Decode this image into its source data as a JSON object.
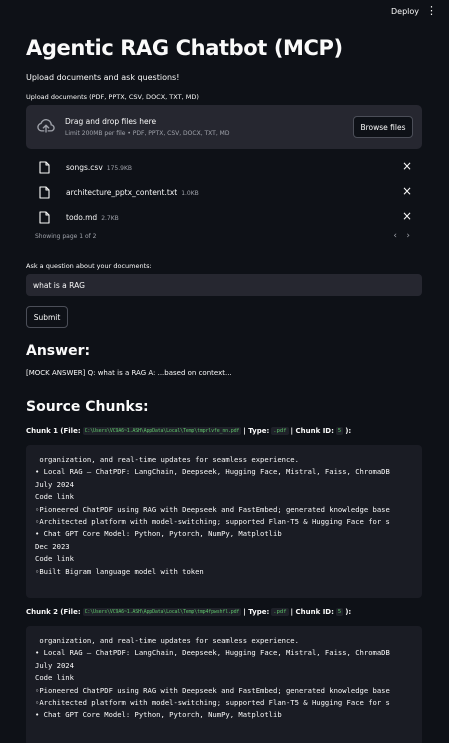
{
  "header": {
    "deploy_label": "Deploy",
    "menu_icon": "kebab-menu-icon"
  },
  "page": {
    "title": "Agentic RAG Chatbot (MCP)",
    "subtitle": "Upload documents and ask questions!"
  },
  "uploader": {
    "label": "Upload documents (PDF, PPTX, CSV, DOCX, TXT, MD)",
    "drag_text": "Drag and drop files here",
    "limit_text": "Limit 200MB per file • PDF, PPTX, CSV, DOCX, TXT, MD",
    "browse_label": "Browse files",
    "files": [
      {
        "name": "songs.csv",
        "size": "175.9KB"
      },
      {
        "name": "architecture_pptx_content.txt",
        "size": "1.0KB"
      },
      {
        "name": "todo.md",
        "size": "2.7KB"
      }
    ],
    "pagination": "Showing page 1 of 2"
  },
  "question": {
    "label": "Ask a question about your documents:",
    "value": "what is a RAG",
    "submit_label": "Submit"
  },
  "answer": {
    "heading": "Answer:",
    "text": "[MOCK ANSWER] Q: what is a RAG A: ...based on context..."
  },
  "sources": {
    "heading": "Source Chunks:",
    "chunks": [
      {
        "label": "Chunk 1",
        "file_prefix": "(File:",
        "file_path": "C:\\Users\\VC9A6~1.ASH\\AppData\\Local\\Temp\\tmprlvfe_nn.pdf",
        "type_label": "| Type:",
        "type_value": ".pdf",
        "id_label": "| Chunk ID:",
        "id_value": "5",
        "suffix": "):",
        "content": " organization, and real-time updates for seamless experience.\n• Local RAG – ChatPDF: LangChain, Deepseek, Hugging Face, Mistral, Faiss, ChromaDB\nJuly 2024\nCode link\n◦Pioneered ChatPDF using RAG with Deepseek and FastEmbed; generated knowledge base\n◦Architected platform with model-switching; supported Flan-T5 & Hugging Face for s\n• Chat GPT Core Model: Python, Pytorch, NumPy, Matplotlib\nDec 2023\nCode link\n◦Built Bigram language model with token"
      },
      {
        "label": "Chunk 2",
        "file_prefix": "(File:",
        "file_path": "C:\\Users\\VC9A6~1.ASH\\AppData\\Local\\Temp\\tmp4fpwshfl.pdf",
        "type_label": "| Type:",
        "type_value": ".pdf",
        "id_label": "| Chunk ID:",
        "id_value": "5",
        "suffix": "):",
        "content": " organization, and real-time updates for seamless experience.\n• Local RAG – ChatPDF: LangChain, Deepseek, Hugging Face, Mistral, Faiss, ChromaDB\nJuly 2024\nCode link\n◦Pioneered ChatPDF using RAG with Deepseek and FastEmbed; generated knowledge base\n◦Architected platform with model-switching; supported Flan-T5 & Hugging Face for s\n• Chat GPT Core Model: Python, Pytorch, NumPy, Matplotlib"
      }
    ]
  },
  "colors": {
    "background": "#0e1117",
    "panel": "#262730",
    "code_bg": "#1a1c24",
    "inline_code": "#5ec26a",
    "text": "#fafafa",
    "muted": "#a0a3ab"
  }
}
